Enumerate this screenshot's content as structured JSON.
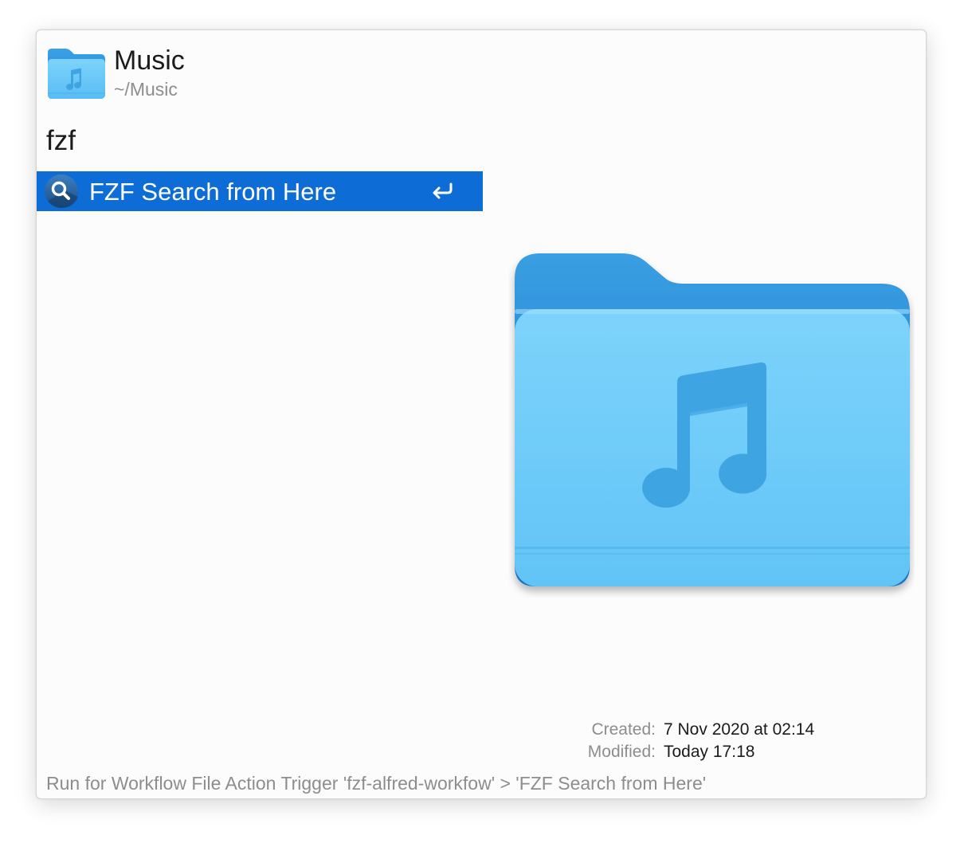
{
  "header": {
    "title": "Music",
    "path": "~/Music",
    "icon": "music-folder-icon"
  },
  "search": {
    "query": "fzf"
  },
  "results": [
    {
      "label": "FZF Search from Here",
      "icon": "search-icon",
      "action_hint": "return-key-icon",
      "selected": true
    }
  ],
  "preview": {
    "icon": "music-folder-icon",
    "meta": [
      {
        "key": "Created:",
        "value": "7 Nov 2020 at 02:14"
      },
      {
        "key": "Modified:",
        "value": "Today 17:18"
      }
    ]
  },
  "status_text": "Run for Workflow File Action Trigger 'fzf-alfred-workfow' > 'FZF Search from Here'",
  "colors": {
    "selection": "#0e6cd6",
    "folder_light": "#74cdf9",
    "folder_dark": "#2f8fd8",
    "note": "#3fa5e2"
  }
}
